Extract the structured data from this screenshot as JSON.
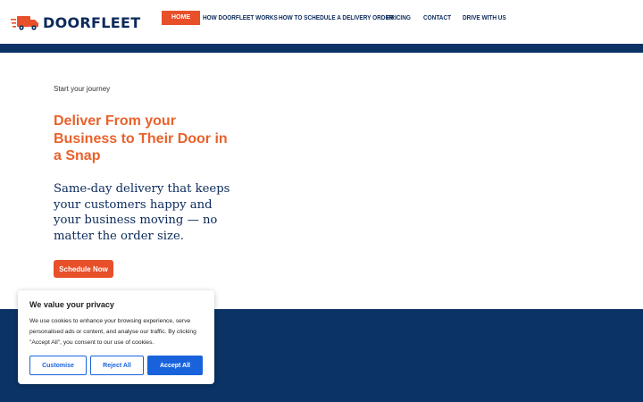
{
  "header": {
    "logo_text": "DOORFLEET",
    "logo_icon": "delivery-truck-icon",
    "nav": [
      {
        "label": "HOME",
        "active": true
      },
      {
        "label": "HOW DOORFLEET WORKS",
        "active": false
      },
      {
        "label": "HOW TO SCHEDULE A DELIVERY ORDER",
        "active": false
      },
      {
        "label": "PRICING",
        "active": false
      },
      {
        "label": "CONTACT",
        "active": false
      },
      {
        "label": "DRIVE WITH US",
        "active": false
      }
    ]
  },
  "hero": {
    "eyebrow": "Start your journey",
    "headline": "Deliver From your Business to Their Door in a Snap",
    "subhead": "Same-day delivery that keeps your customers happy and your business moving — no matter the order size.",
    "cta_label": "Schedule Now"
  },
  "cookie": {
    "title": "We value your privacy",
    "body": "We use cookies to enhance your browsing experience, serve personalised ads or content, and analyse our traffic. By clicking \"Accept All\", you consent to our use of cookies.",
    "buttons": {
      "customise": "Customise",
      "reject": "Reject All",
      "accept": "Accept All"
    }
  },
  "colors": {
    "brand_navy": "#0b3366",
    "brand_orange": "#e8502a",
    "headline_orange": "#e8622c",
    "cookie_blue": "#1863dc"
  }
}
